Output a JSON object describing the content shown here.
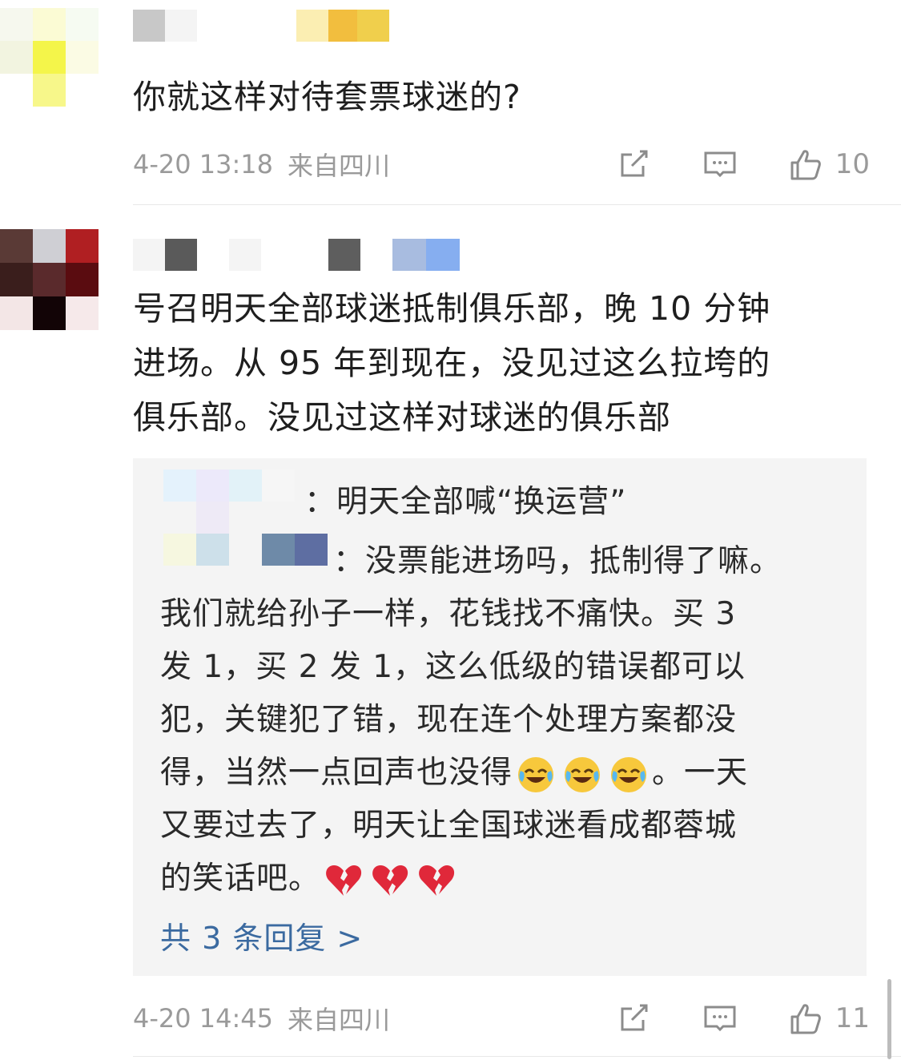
{
  "comments": [
    {
      "text": "你就这样对待套票球迷的?",
      "time": "4-20 13:18",
      "location": "来自四川",
      "likes": "10",
      "icons": [
        "share-icon",
        "comment-icon",
        "thumbs-up-icon"
      ]
    },
    {
      "lines": [
        "号召明天全部球迷抵制俱乐部，晚 10 分钟",
        "进场。从 95 年到现在，没见过这么拉垮的",
        "俱乐部。没见过这样对球迷的俱乐部"
      ],
      "time": "4-20 14:45",
      "location": "来自四川",
      "likes": "11",
      "replies": {
        "reply1": "：明天全部喊“换运营”",
        "reply2_start": "：没票能进场吗，抵制得了嘛。",
        "reply2_lines": [
          "我们就给孙子一样，花钱找不痛快。买 3",
          "发 1，买 2 发 1，这么低级的错误都可以",
          "犯，关键犯了错，现在连个处理方案都没"
        ],
        "line6_text": "得，当然一点回声也没得",
        "line6_end": "。一天",
        "line7": "又要过去了，明天让全国球迷看成都蓉城",
        "line8": "的笑话吧。",
        "emoji_laugh": "laugh-cry-emoji",
        "emoji_heart": "broken-heart-emoji",
        "more_label": "共 3 条回复 >"
      }
    }
  ],
  "colors": {
    "link": "#3b6aa0",
    "meta": "#9a9a9a",
    "reply_bg": "#f4f4f4"
  }
}
